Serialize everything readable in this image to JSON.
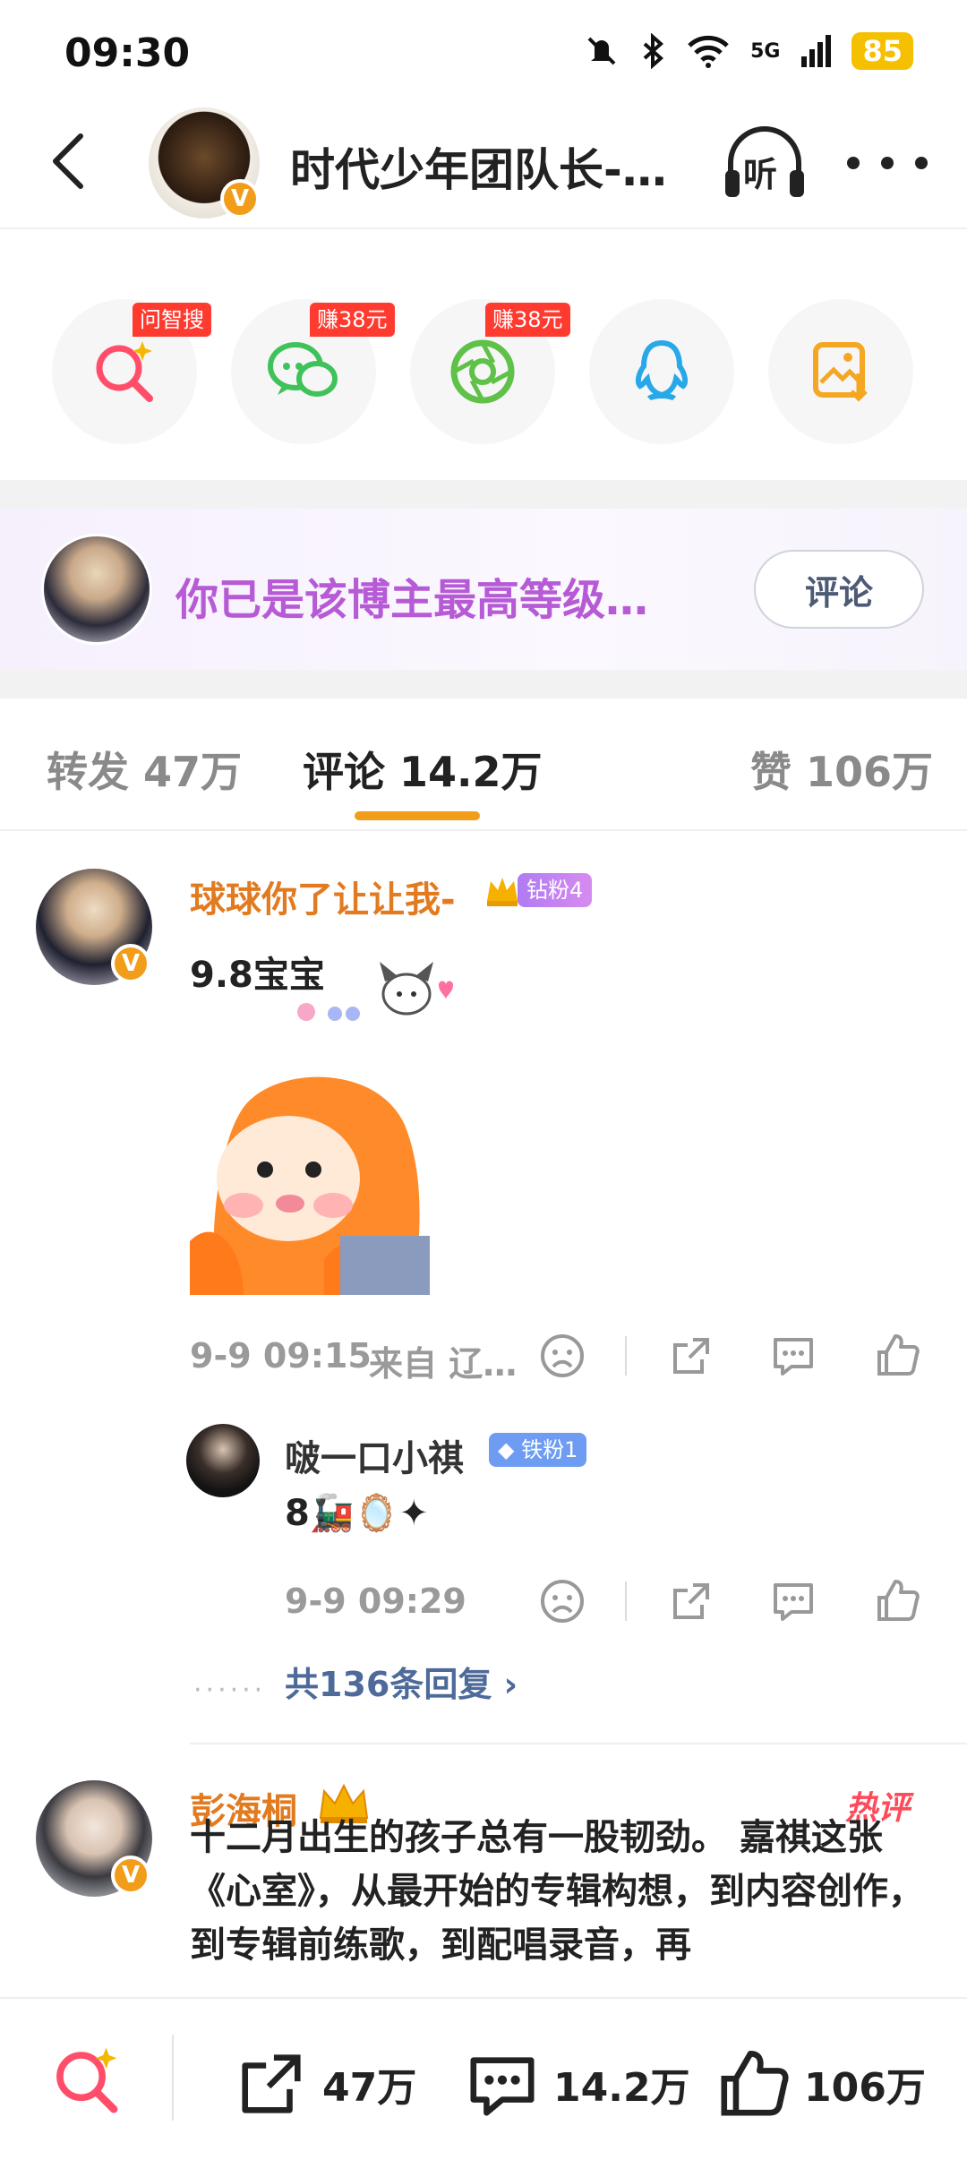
{
  "status_bar": {
    "time": "09:30",
    "battery": "85",
    "network": "5G"
  },
  "header": {
    "title": "时代少年团队长-…",
    "listen_label": "听"
  },
  "share_row": {
    "items": [
      {
        "icon": "ai-search-icon",
        "tag": "问智搜"
      },
      {
        "icon": "wechat-icon",
        "tag": "赚38元"
      },
      {
        "icon": "moments-icon",
        "tag": "赚38元"
      },
      {
        "icon": "qq-icon",
        "tag": ""
      },
      {
        "icon": "save-image-icon",
        "tag": ""
      }
    ]
  },
  "fan_banner": {
    "text": "你已是该博主最高等级…",
    "button": "评论"
  },
  "tabs": {
    "repost": "转发 47万",
    "comments": "评论 14.2万",
    "likes": "赞 106万"
  },
  "comments": [
    {
      "username": "球球你了让让我-",
      "badge": "钻粉4",
      "text": "9.8宝宝",
      "time": "9-9 09:15",
      "source": "来自 辽…"
    },
    {
      "username": "啵一口小祺",
      "badge": "铁粉1",
      "text": "8🚂🪞✦",
      "time": "9-9 09:29",
      "more_replies": "共136条回复 ›"
    },
    {
      "username": "彭海桐",
      "hot_label": "热评",
      "text": "十二月出生的孩子总有一股韧劲。 嘉祺这张《心室》，从最开始的专辑构想，到内容创作，到专辑前练歌，到配唱录音，再"
    }
  ],
  "bottom_bar": {
    "repost": "47万",
    "comments": "14.2万",
    "likes": "106万"
  },
  "colors": {
    "accent": "#f29d19",
    "username": "#e27a20",
    "fan_text": "#b65ad6",
    "tag_red": "#ff3b30"
  }
}
